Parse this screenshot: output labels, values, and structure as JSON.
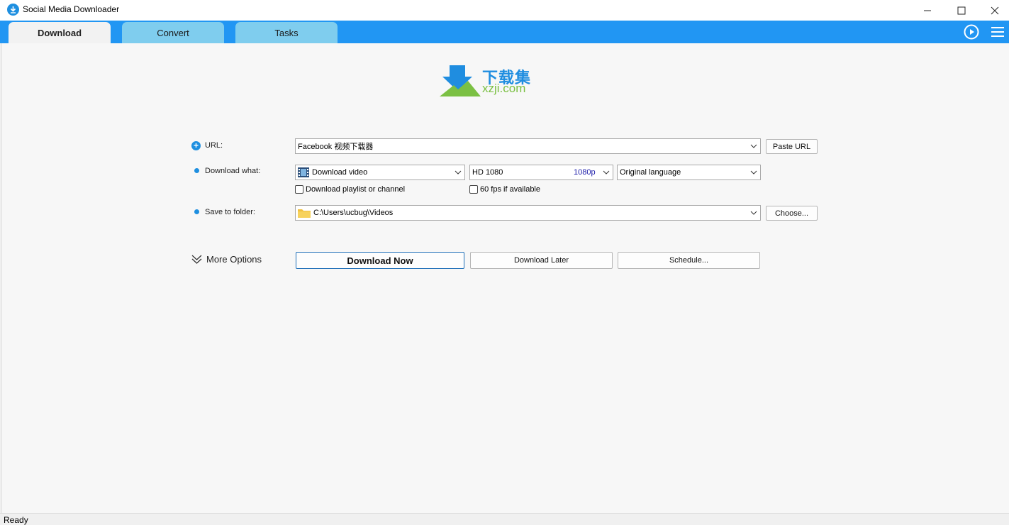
{
  "window": {
    "title": "Social Media Downloader",
    "minimize_icon": "minimize-icon",
    "maximize_icon": "maximize-icon",
    "close_icon": "close-icon"
  },
  "tabs": [
    {
      "label": "Download",
      "active": true
    },
    {
      "label": "Convert",
      "active": false
    },
    {
      "label": "Tasks",
      "active": false
    }
  ],
  "header_icons": [
    "play-circle-icon",
    "menu-icon"
  ],
  "logo": {
    "cn": "下载集",
    "en": "xzji.com"
  },
  "form": {
    "url_label": "URL:",
    "url_value": "Facebook 视频下载器",
    "paste_button": "Paste URL",
    "download_what_label": "Download what:",
    "download_type": "Download video",
    "quality": "HD 1080",
    "quality_tag": "1080p",
    "language": "Original language",
    "playlist_checkbox": "Download playlist or channel",
    "fps_checkbox": "60 fps if available",
    "save_label": "Save to folder:",
    "folder_path": "C:\\Users\\ucbug\\Videos",
    "choose_button": "Choose..."
  },
  "actions": {
    "more_options": "More Options",
    "download_now": "Download Now",
    "download_later": "Download Later",
    "schedule": "Schedule..."
  },
  "status": {
    "text": "Ready"
  },
  "colors": {
    "accent": "#2196f3",
    "tab_inactive": "#7fcdee",
    "logo_blue": "#1f8de0",
    "logo_green": "#7bc043"
  }
}
